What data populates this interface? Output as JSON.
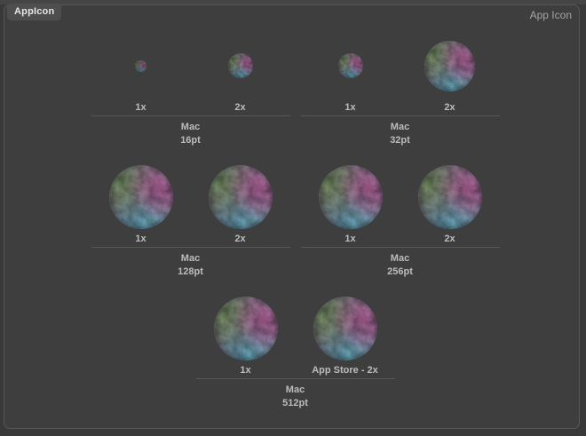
{
  "window": {
    "badge_label": "AppIcon",
    "header_label": "App Icon"
  },
  "icon_set": {
    "rows": [
      [
        0,
        1
      ],
      [
        2,
        3
      ],
      [
        4
      ]
    ],
    "groups": [
      {
        "device": "Mac",
        "size_label": "16pt",
        "cells": [
          {
            "scale_label": "1x",
            "icon_size": 13
          },
          {
            "scale_label": "2x",
            "icon_size": 28
          }
        ]
      },
      {
        "device": "Mac",
        "size_label": "32pt",
        "cells": [
          {
            "scale_label": "1x",
            "icon_size": 28
          },
          {
            "scale_label": "2x",
            "icon_size": 57
          }
        ]
      },
      {
        "device": "Mac",
        "size_label": "128pt",
        "cells": [
          {
            "scale_label": "1x",
            "icon_size": 72
          },
          {
            "scale_label": "2x",
            "icon_size": 72
          }
        ]
      },
      {
        "device": "Mac",
        "size_label": "256pt",
        "cells": [
          {
            "scale_label": "1x",
            "icon_size": 72
          },
          {
            "scale_label": "2x",
            "icon_size": 72
          }
        ]
      },
      {
        "device": "Mac",
        "size_label": "512pt",
        "cells": [
          {
            "scale_label": "1x",
            "icon_size": 72
          },
          {
            "scale_label": "App Store - 2x",
            "icon_size": 72
          }
        ]
      }
    ],
    "image_description": "full moon with green, magenta and teal color tint"
  },
  "colors": {
    "background": "#3e3e3e",
    "outer_background": "#393939",
    "panel_border": "#575757",
    "divider": "#585858",
    "label_text": "#bcbcbc",
    "header_text": "#a3a3a3",
    "badge_bg": "#4e4e4e",
    "badge_text": "#e6e6e6",
    "moon_green": "#7a9c64",
    "moon_magenta": "#bc5fa0",
    "moon_teal": "#5fa5b9",
    "moon_base": "#8a8090"
  }
}
